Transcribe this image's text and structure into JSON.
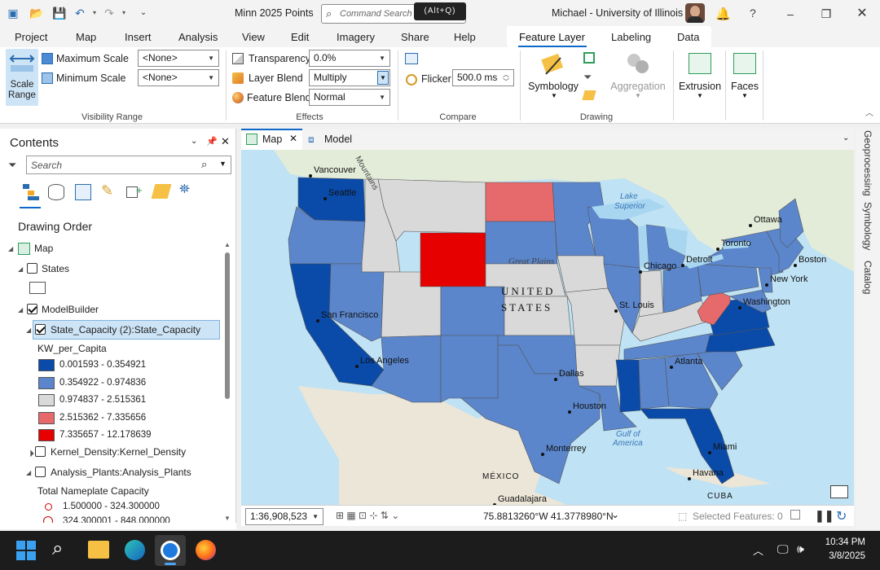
{
  "window": {
    "title": "Minn 2025 Points",
    "user": "Michael - University of Illinois",
    "command_search_placeholder": "Command Search",
    "command_search_shortcut": "(Alt+Q)"
  },
  "menu_tabs": [
    "Project",
    "Map",
    "Insert",
    "Analysis",
    "View",
    "Edit",
    "Imagery",
    "Share",
    "Help"
  ],
  "context_tabs": [
    "Feature Layer",
    "Labeling",
    "Data"
  ],
  "ribbon": {
    "visibility": {
      "scale_range_label": "Scale Range",
      "max_scale_label": "Maximum Scale",
      "max_scale_value": "<None>",
      "min_scale_label": "Minimum Scale",
      "min_scale_value": "<None>",
      "group_label": "Visibility Range"
    },
    "effects": {
      "transparency_label": "Transparency",
      "transparency_value": "0.0%",
      "layer_blend_label": "Layer Blend",
      "layer_blend_value": "Multiply",
      "feature_blend_label": "Feature Blend",
      "feature_blend_value": "Normal",
      "group_label": "Effects"
    },
    "compare": {
      "flicker_label": "Flicker",
      "flicker_value": "500.0",
      "flicker_unit": "ms",
      "group_label": "Compare"
    },
    "drawing": {
      "symbology_label": "Symbology",
      "aggregation_label": "Aggregation",
      "extrusion_label": "Extrusion",
      "faces_label": "Faces",
      "group_label": "Drawing"
    }
  },
  "contents": {
    "title": "Contents",
    "search_placeholder": "Search",
    "drawing_order": "Drawing Order",
    "layers": {
      "map": "Map",
      "states": "States",
      "modelbuilder": "ModelBuilder",
      "state_capacity": "State_Capacity (2):State_Capacity",
      "field": "KW_per_Capita",
      "kernel": "Kernel_Density:Kernel_Density",
      "plants": "Analysis_Plants:Analysis_Plants",
      "plants_field": "Total Nameplate Capacity",
      "plants_class1": "1.500000 - 324.300000",
      "plants_class2": "324.300001 - 848.000000"
    },
    "legend": [
      {
        "label": "0.001593 - 0.354921",
        "color": "#0a4aa8"
      },
      {
        "label": "0.354922 - 0.974836",
        "color": "#5b86cc"
      },
      {
        "label": "0.974837 - 2.515361",
        "color": "#d9d9d9"
      },
      {
        "label": "2.515362 - 7.335656",
        "color": "#e6696b"
      },
      {
        "label": "7.335657 - 12.178639",
        "color": "#e60000"
      }
    ]
  },
  "map_tabs": {
    "map": "Map",
    "model": "Model"
  },
  "map": {
    "cities": [
      "Vancouver",
      "Seattle",
      "San Francisco",
      "Los Angeles",
      "Dallas",
      "Houston",
      "Monterrey",
      "Guadalajara",
      "Chicago",
      "St. Louis",
      "Atlanta",
      "Miami",
      "Havana",
      "Washington",
      "New York",
      "Boston",
      "Detroit",
      "Toronto",
      "Ottawa"
    ],
    "labels": {
      "united": "UNITED",
      "states": "STATES",
      "great_plains": "Great Plains",
      "lake_superior_1": "Lake",
      "lake_superior_2": "Superior",
      "gulf1": "Gulf of",
      "gulf2": "America",
      "mexico": "MÉXICO",
      "cuba": "CUBA",
      "mountains": "Mountains"
    }
  },
  "map_footer": {
    "scale": "1:36,908,523",
    "coords": "75.8813260°W 41.3778980°N",
    "selected": "Selected Features: 0"
  },
  "right_rail": [
    "Geoprocessing",
    "Symbology",
    "Catalog"
  ],
  "taskbar": {
    "time": "10:34 PM",
    "date": "3/8/2025"
  }
}
